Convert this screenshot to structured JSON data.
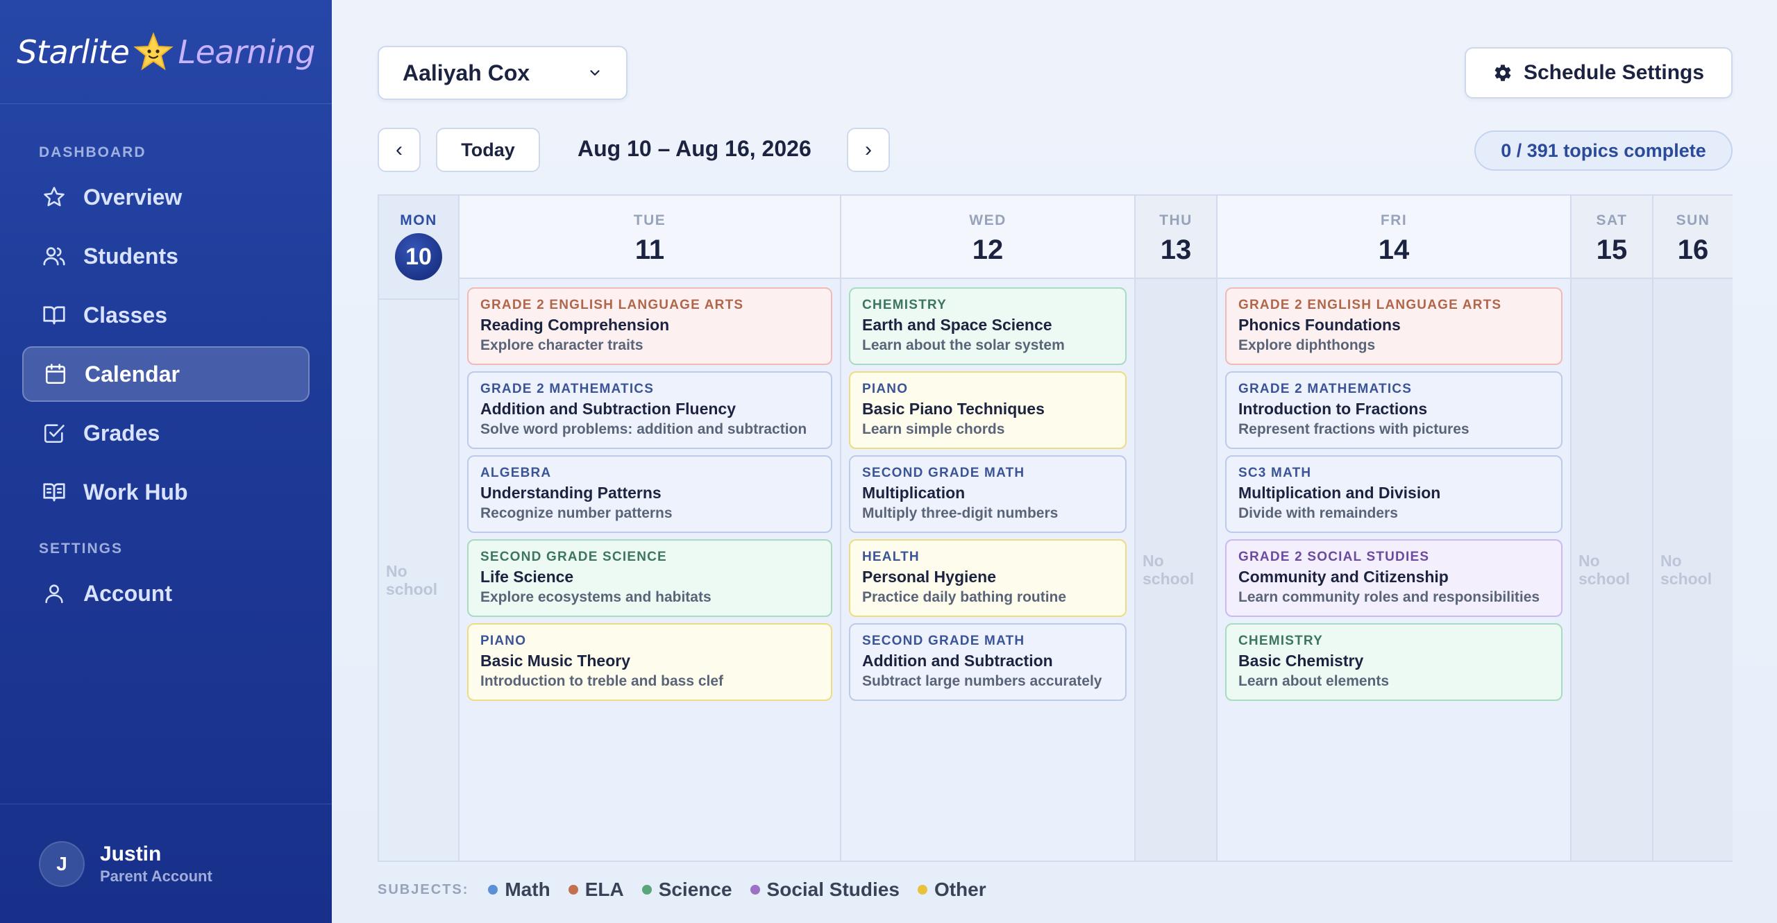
{
  "app": {
    "logo": {
      "part1": "Starlite",
      "part2": "Learning"
    }
  },
  "sidebar": {
    "dashboard_label": "DASHBOARD",
    "settings_label": "SETTINGS",
    "items": [
      {
        "label": "Overview",
        "icon": "star-icon"
      },
      {
        "label": "Students",
        "icon": "users-icon"
      },
      {
        "label": "Classes",
        "icon": "book-icon"
      },
      {
        "label": "Calendar",
        "icon": "calendar-icon",
        "active": true
      },
      {
        "label": "Grades",
        "icon": "checkbox-icon"
      },
      {
        "label": "Work Hub",
        "icon": "open-book-icon"
      }
    ],
    "settings_items": [
      {
        "label": "Account",
        "icon": "person-icon"
      }
    ],
    "user": {
      "initial": "J",
      "name": "Justin",
      "role": "Parent Account"
    }
  },
  "header": {
    "student": "Aaliyah Cox",
    "settings_button": "Schedule Settings",
    "prev": "‹",
    "next": "›",
    "today_button": "Today",
    "date_range": "Aug 10 – Aug 16, 2026",
    "progress": "0 / 391 topics complete"
  },
  "calendar": {
    "no_school": "No school",
    "days": [
      {
        "dow": "MON",
        "num": "10",
        "today": true,
        "school": false
      },
      {
        "dow": "TUE",
        "num": "11",
        "school": true,
        "topics": [
          {
            "subject": "GRADE 2 ENGLISH LANGUAGE ARTS",
            "title": "Reading Comprehension",
            "desc": "Explore character traits",
            "kind": "ela"
          },
          {
            "subject": "GRADE 2 MATHEMATICS",
            "title": "Addition and Subtraction Fluency",
            "desc": "Solve word problems: addition and subtraction",
            "kind": "math"
          },
          {
            "subject": "ALGEBRA",
            "title": "Understanding Patterns",
            "desc": "Recognize number patterns",
            "kind": "math"
          },
          {
            "subject": "SECOND GRADE SCIENCE",
            "title": "Life Science",
            "desc": "Explore ecosystems and habitats",
            "kind": "sci"
          },
          {
            "subject": "PIANO",
            "title": "Basic Music Theory",
            "desc": "Introduction to treble and bass clef",
            "kind": "other"
          }
        ]
      },
      {
        "dow": "WED",
        "num": "12",
        "school": true,
        "topics": [
          {
            "subject": "CHEMISTRY",
            "title": "Earth and Space Science",
            "desc": "Learn about the solar system",
            "kind": "sci"
          },
          {
            "subject": "PIANO",
            "title": "Basic Piano Techniques",
            "desc": "Learn simple chords",
            "kind": "other"
          },
          {
            "subject": "SECOND GRADE MATH",
            "title": "Multiplication",
            "desc": "Multiply three-digit numbers",
            "kind": "math"
          },
          {
            "subject": "HEALTH",
            "title": "Personal Hygiene",
            "desc": "Practice daily bathing routine",
            "kind": "other"
          },
          {
            "subject": "SECOND GRADE MATH",
            "title": "Addition and Subtraction",
            "desc": "Subtract large numbers accurately",
            "kind": "math"
          }
        ]
      },
      {
        "dow": "THU",
        "num": "13",
        "school": false
      },
      {
        "dow": "FRI",
        "num": "14",
        "school": true,
        "topics": [
          {
            "subject": "GRADE 2 ENGLISH LANGUAGE ARTS",
            "title": "Phonics Foundations",
            "desc": "Explore diphthongs",
            "kind": "ela"
          },
          {
            "subject": "GRADE 2 MATHEMATICS",
            "title": "Introduction to Fractions",
            "desc": "Represent fractions with pictures",
            "kind": "math"
          },
          {
            "subject": "SC3 MATH",
            "title": "Multiplication and Division",
            "desc": "Divide with remainders",
            "kind": "math"
          },
          {
            "subject": "GRADE 2 SOCIAL STUDIES",
            "title": "Community and Citizenship",
            "desc": "Learn community roles and responsibilities",
            "kind": "soc"
          },
          {
            "subject": "CHEMISTRY",
            "title": "Basic Chemistry",
            "desc": "Learn about elements",
            "kind": "sci"
          }
        ]
      },
      {
        "dow": "SAT",
        "num": "15",
        "school": false
      },
      {
        "dow": "SUN",
        "num": "16",
        "school": false
      }
    ]
  },
  "legend": {
    "label": "SUBJECTS:",
    "items": [
      {
        "label": "Math",
        "color": "#5b8fd6"
      },
      {
        "label": "ELA",
        "color": "#c2704f"
      },
      {
        "label": "Science",
        "color": "#5aa57a"
      },
      {
        "label": "Social Studies",
        "color": "#9b72c6"
      },
      {
        "label": "Other",
        "color": "#e8c23a"
      }
    ]
  }
}
